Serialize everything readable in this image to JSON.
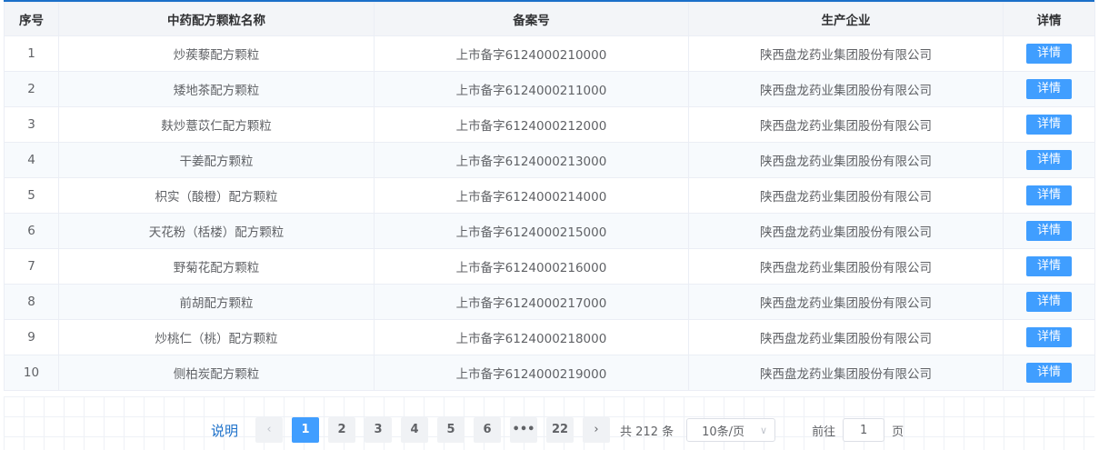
{
  "table": {
    "headers": [
      "序号",
      "中药配方颗粒名称",
      "备案号",
      "生产企业",
      "详情"
    ],
    "rows": [
      {
        "index": "1",
        "name": "炒蒺藜配方颗粒",
        "record": "上市备字6124000210000",
        "company": "陕西盘龙药业集团股份有限公司",
        "action": "详情"
      },
      {
        "index": "2",
        "name": "矮地茶配方颗粒",
        "record": "上市备字6124000211000",
        "company": "陕西盘龙药业集团股份有限公司",
        "action": "详情"
      },
      {
        "index": "3",
        "name": "麸炒薏苡仁配方颗粒",
        "record": "上市备字6124000212000",
        "company": "陕西盘龙药业集团股份有限公司",
        "action": "详情"
      },
      {
        "index": "4",
        "name": "干姜配方颗粒",
        "record": "上市备字6124000213000",
        "company": "陕西盘龙药业集团股份有限公司",
        "action": "详情"
      },
      {
        "index": "5",
        "name": "枳实（酸橙）配方颗粒",
        "record": "上市备字6124000214000",
        "company": "陕西盘龙药业集团股份有限公司",
        "action": "详情"
      },
      {
        "index": "6",
        "name": "天花粉（栝楼）配方颗粒",
        "record": "上市备字6124000215000",
        "company": "陕西盘龙药业集团股份有限公司",
        "action": "详情"
      },
      {
        "index": "7",
        "name": "野菊花配方颗粒",
        "record": "上市备字6124000216000",
        "company": "陕西盘龙药业集团股份有限公司",
        "action": "详情"
      },
      {
        "index": "8",
        "name": "前胡配方颗粒",
        "record": "上市备字6124000217000",
        "company": "陕西盘龙药业集团股份有限公司",
        "action": "详情"
      },
      {
        "index": "9",
        "name": "炒桃仁（桃）配方颗粒",
        "record": "上市备字6124000218000",
        "company": "陕西盘龙药业集团股份有限公司",
        "action": "详情"
      },
      {
        "index": "10",
        "name": "侧柏炭配方颗粒",
        "record": "上市备字6124000219000",
        "company": "陕西盘龙药业集团股份有限公司",
        "action": "详情"
      }
    ]
  },
  "pagination": {
    "help_label": "说明",
    "prev_icon": "chevron-left-icon",
    "next_icon": "chevron-right-icon",
    "prev_glyph": "‹",
    "next_glyph": "›",
    "pages": [
      "1",
      "2",
      "3",
      "4",
      "5",
      "6",
      "•••",
      "22"
    ],
    "current_page": "1",
    "total_text": "共 212 条",
    "page_size_selected": "10条/页",
    "goto_label": "前往",
    "goto_value": "1",
    "goto_suffix": "页"
  },
  "colors": {
    "accent": "#409eff",
    "header_bg": "#f3f5f8",
    "top_border": "#1a6fc9",
    "help_link": "#1a6fc9"
  }
}
